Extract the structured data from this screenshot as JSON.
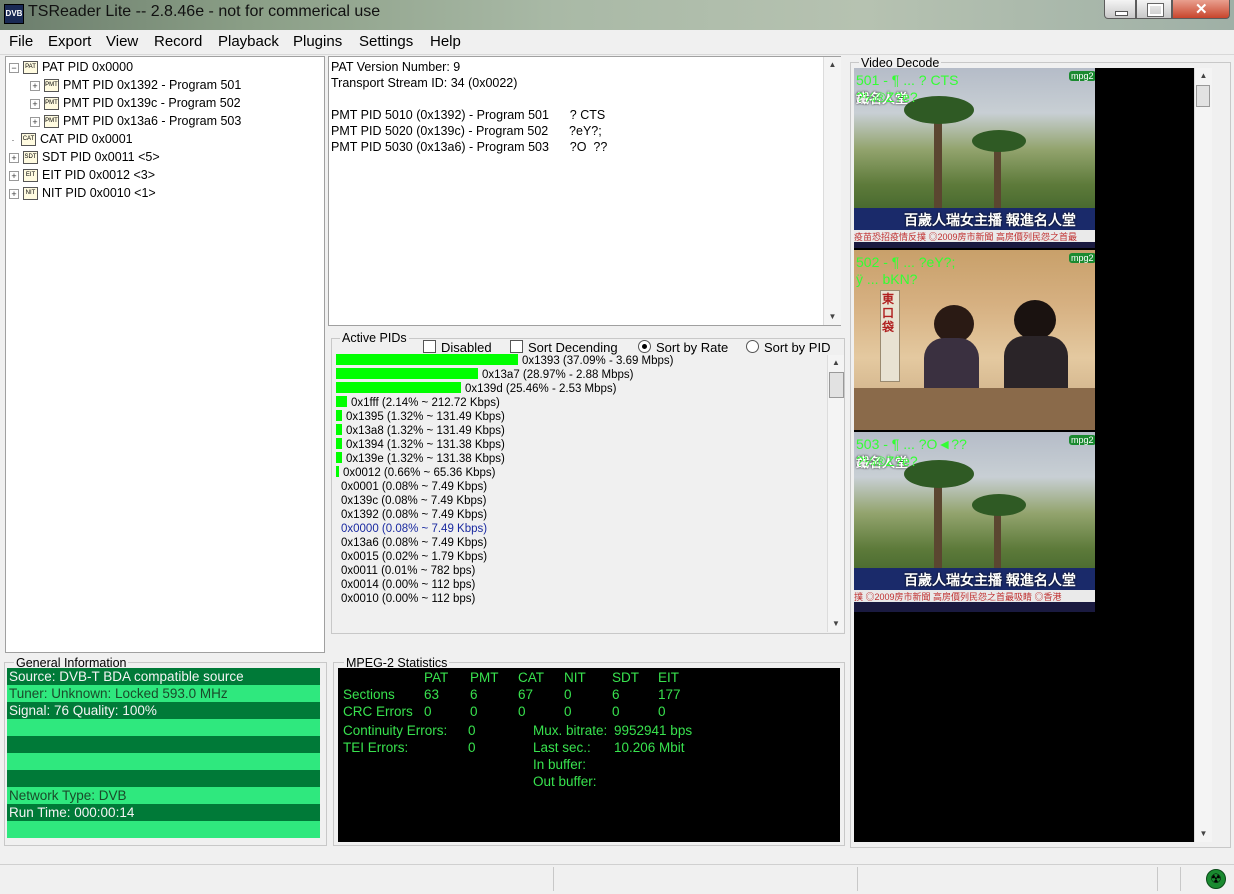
{
  "window": {
    "title": "TSReader Lite -- 2.8.46e - not for commerical use",
    "icon_text": "DVB"
  },
  "menu": [
    "File",
    "Export",
    "View",
    "Record",
    "Playback",
    "Plugins",
    "Settings",
    "Help"
  ],
  "tree": {
    "items": [
      {
        "label": "PAT PID 0x0000",
        "expander": "−",
        "level": 0
      },
      {
        "label": "PMT PID 0x1392 - Program 501",
        "expander": "+",
        "level": 1
      },
      {
        "label": "PMT PID 0x139c - Program 502",
        "expander": "+",
        "level": 1
      },
      {
        "label": "PMT PID 0x13a6 - Program 503",
        "expander": "+",
        "level": 1
      },
      {
        "label": "CAT PID 0x0001",
        "expander": "",
        "level": 0
      },
      {
        "label": "SDT PID 0x0011 <5>",
        "expander": "+",
        "level": 0
      },
      {
        "label": "EIT PID 0x0012 <3>",
        "expander": "+",
        "level": 0
      },
      {
        "label": "NIT PID 0x0010 <1>",
        "expander": "+",
        "level": 0
      }
    ],
    "icons": [
      "PAT",
      "PMT",
      "PMT",
      "PMT",
      "CAT",
      "SDT",
      "EIT",
      "NIT"
    ]
  },
  "pat_details": {
    "lines": [
      "PAT Version Number: 9",
      "Transport Stream ID: 34 (0x0022)",
      "",
      "PMT PID 5010 (0x1392) - Program 501      ? CTS",
      "PMT PID 5020 (0x139c) - Program 502      ?eY?;",
      "PMT PID 5030 (0x13a6) - Program 503      ?O  ??"
    ]
  },
  "active_pids": {
    "title": "Active PIDs",
    "options": {
      "disabled": "Disabled",
      "sort_desc": "Sort Decending",
      "sort_rate": "Sort by Rate",
      "sort_pid": "Sort by PID"
    },
    "rows": [
      {
        "text": "0x1393 (37.09% - 3.69 Mbps)",
        "share": 0.3709
      },
      {
        "text": "0x13a7 (28.97% - 2.88 Mbps)",
        "share": 0.2897
      },
      {
        "text": "0x139d (25.46% - 2.53 Mbps)",
        "share": 0.2546
      },
      {
        "text": "0x1fff (2.14% ~ 212.72 Kbps)",
        "share": 0.0214
      },
      {
        "text": "0x1395 (1.32% ~ 131.49 Kbps)",
        "share": 0.0132
      },
      {
        "text": "0x13a8 (1.32% ~ 131.49 Kbps)",
        "share": 0.0132
      },
      {
        "text": "0x1394 (1.32% ~ 131.38 Kbps)",
        "share": 0.0132
      },
      {
        "text": "0x139e (1.32% ~ 131.38 Kbps)",
        "share": 0.0132
      },
      {
        "text": "0x0012 (0.66% ~ 65.36 Kbps)",
        "share": 0.0066
      },
      {
        "text": "0x0001 (0.08% ~ 7.49 Kbps)",
        "share": 0
      },
      {
        "text": "0x139c (0.08% ~ 7.49 Kbps)",
        "share": 0
      },
      {
        "text": "0x1392 (0.08% ~ 7.49 Kbps)",
        "share": 0
      },
      {
        "text": "0x0000 (0.08% ~ 7.49 Kbps)",
        "share": 0,
        "highlight": true
      },
      {
        "text": "0x13a6 (0.08% ~ 7.49 Kbps)",
        "share": 0
      },
      {
        "text": "0x0015 (0.02% ~ 1.79 Kbps)",
        "share": 0
      },
      {
        "text": "0x0011 (0.01% ~ 782 bps)",
        "share": 0
      },
      {
        "text": "0x0014 (0.00% ~ 112 bps)",
        "share": 0
      },
      {
        "text": "0x0010 (0.00% ~ 112 bps)",
        "share": 0
      }
    ]
  },
  "general_info": {
    "title": "General Information",
    "rows": [
      "Source: DVB-T BDA compatible source",
      "Tuner: Unknown: Locked 593.0 MHz",
      "Signal: 76 Quality: 100%",
      "",
      "",
      "",
      "",
      "Network Type: DVB",
      "Run Time: 000:00:14",
      ""
    ]
  },
  "mpeg_stats": {
    "title": "MPEG-2 Statistics",
    "columns": [
      "PAT",
      "PMT",
      "CAT",
      "NIT",
      "SDT",
      "EIT"
    ],
    "sections_label": "Sections",
    "sections": [
      "63",
      "6",
      "67",
      "0",
      "6",
      "177"
    ],
    "crc_label": "CRC Errors",
    "crc": [
      "0",
      "0",
      "0",
      "0",
      "0",
      "0"
    ],
    "continuity_label": "Continuity Errors:",
    "continuity": "0",
    "tei_label": "TEI Errors:",
    "tei": "0",
    "mux_label": "Mux. bitrate:",
    "mux": "9952941 bps",
    "lastsec_label": "Last sec.:",
    "lastsec": "10.206 Mbit",
    "inbuf_label": "In buffer:",
    "outbuf_label": "Out buffer:"
  },
  "video": {
    "title": "Video Decode",
    "thumbs": [
      {
        "osd1": "501 - ¶ ... ? CTS",
        "osd2": "?¼®Z?e?",
        "codec": "mpg2",
        "caption": "百歲人瑞女主播 報進名人堂",
        "corner": "鐵名人堂",
        "ticker": "疫苗恐招疫情反撲 ◎2009房市新聞 高房價列民怨之首最"
      },
      {
        "osd1": "502 - ¶ ... ?eY?;",
        "osd2": "ÿ ... bKN?",
        "codec": "mpg2",
        "caption": "東口袋",
        "corner": "",
        "ticker": ""
      },
      {
        "osd1": "503 - ¶ ... ?O◄??",
        "osd2": "?¼®Z?e?",
        "codec": "mpg2",
        "caption": "百歲人瑞女主播 報進名人堂",
        "corner": "鐵名人堂",
        "ticker": "撲 ◎2009房市新聞 高房價列民怨之首最吸睛 ◎香港"
      }
    ]
  },
  "colors": {
    "bar": "#00ff00",
    "stats_text": "#38e24e",
    "gi_dark": "#007a38",
    "gi_light": "#2fe87e"
  }
}
